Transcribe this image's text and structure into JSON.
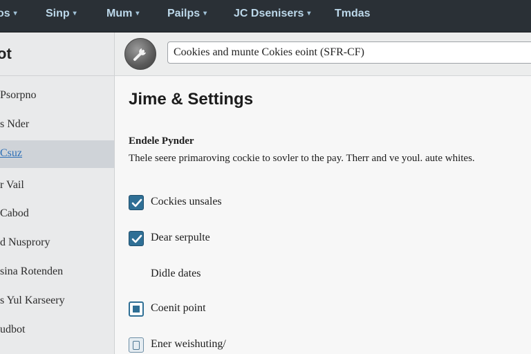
{
  "menu": {
    "items": [
      {
        "label": "os",
        "caret": "▾"
      },
      {
        "label": "Sinp",
        "caret": "▾"
      },
      {
        "label": "Mum",
        "caret": "▾"
      },
      {
        "label": "Pailps",
        "caret": "▾"
      },
      {
        "label": "JC Dsenisers",
        "caret": "▾"
      },
      {
        "label": "Tmdas",
        "caret": ""
      }
    ]
  },
  "sidebar": {
    "title": "ot",
    "items": [
      {
        "label": "Psorpno"
      },
      {
        "label": "s Nder"
      },
      {
        "label": "Csuz",
        "active": true
      },
      {
        "label": "r Vail"
      },
      {
        "label": "Cabod"
      },
      {
        "label": "d Nusprory"
      },
      {
        "label": "sina Rotenden"
      },
      {
        "label": "s Yul Karseery"
      },
      {
        "label": "udbot"
      }
    ]
  },
  "toolbar": {
    "icon": "wrench-icon",
    "address": "Cookies and munte Cokies eoint (SFR-CF)"
  },
  "main": {
    "title": "Jime & Settings",
    "section_title": "Endele Pynder",
    "section_desc": "Thele seere primaroving cockie to sovler to the pay. Therr and ve youl. aute whites.",
    "options": [
      {
        "label": "Cockies unsales",
        "state": "checked"
      },
      {
        "label": "Dear serpulte",
        "state": "checked"
      },
      {
        "label": "Didle dates",
        "state": "none"
      },
      {
        "label": "Coenit point",
        "state": "partial"
      },
      {
        "label": "Ener weishuting/",
        "state": "pending"
      }
    ]
  },
  "colors": {
    "menubar": "#2a3036",
    "menu_text": "#bcd8ea",
    "sidebar_bg": "#e9eaeb",
    "active_item_bg": "#cfd3d8",
    "link_blue": "#2d6fb7",
    "checkbox_blue": "#2f6f95"
  }
}
